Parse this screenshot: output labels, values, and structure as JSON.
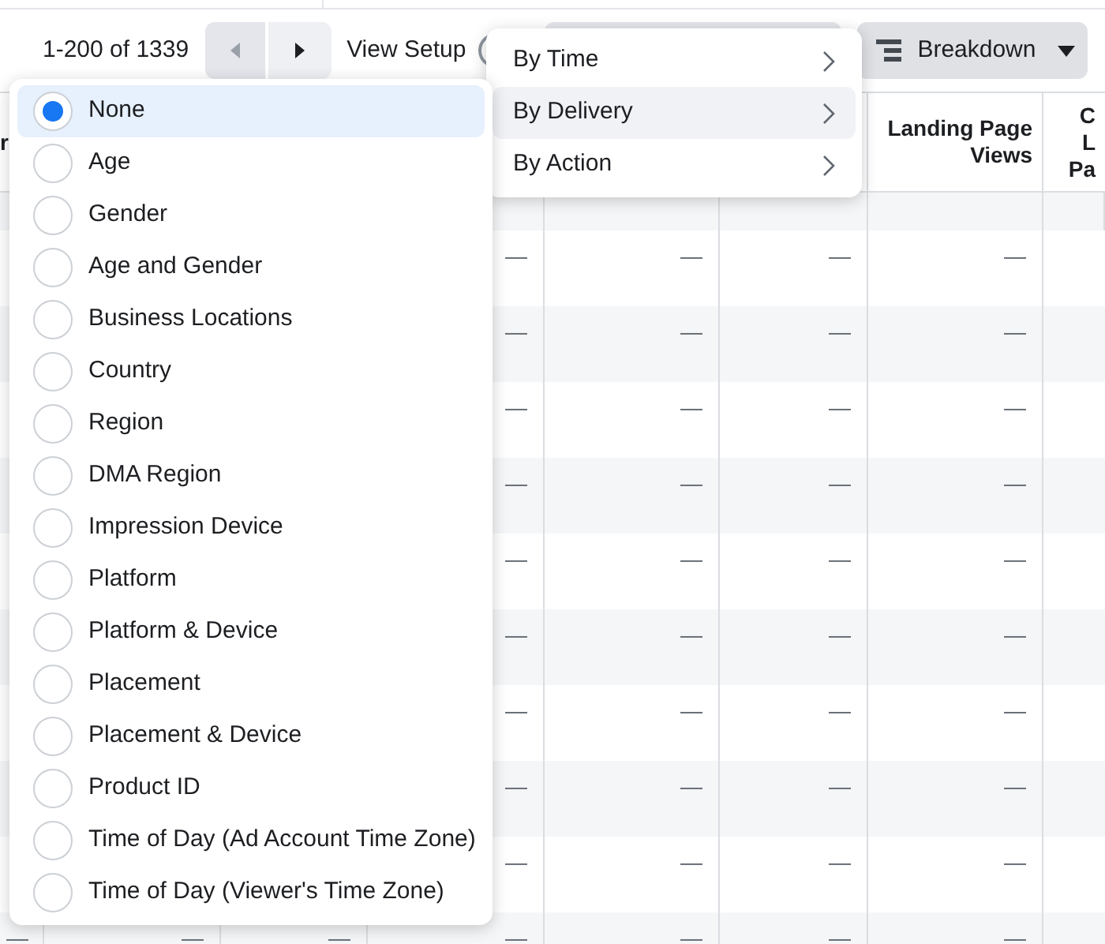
{
  "toolbar": {
    "range": "1-200 of 1339",
    "prev_disabled": true,
    "next_disabled": false,
    "view_setup": "View Setup",
    "view_setup_on": false,
    "breakdown": "Breakdown"
  },
  "breakdown_menu": [
    {
      "label": "By Time",
      "selected": false
    },
    {
      "label": "By Delivery",
      "selected": true
    },
    {
      "label": "By Action",
      "selected": false
    }
  ],
  "delivery_options": [
    {
      "label": "None",
      "selected": true
    },
    {
      "label": "Age",
      "selected": false
    },
    {
      "label": "Gender",
      "selected": false
    },
    {
      "label": "Age and Gender",
      "selected": false
    },
    {
      "label": "Business Locations",
      "selected": false
    },
    {
      "label": "Country",
      "selected": false
    },
    {
      "label": "Region",
      "selected": false
    },
    {
      "label": "DMA Region",
      "selected": false
    },
    {
      "label": "Impression Device",
      "selected": false
    },
    {
      "label": "Platform",
      "selected": false
    },
    {
      "label": "Platform & Device",
      "selected": false
    },
    {
      "label": "Placement",
      "selected": false
    },
    {
      "label": "Placement & Device",
      "selected": false
    },
    {
      "label": "Product ID",
      "selected": false
    },
    {
      "label": "Time of Day (Ad Account Time Zone)",
      "selected": false
    },
    {
      "label": "Time of Day (Viewer's Time Zone)",
      "selected": false
    }
  ],
  "table": {
    "columns": [
      {
        "header": [
          "r"
        ]
      },
      {},
      {},
      {},
      {},
      {},
      {
        "header": [
          "Landing Page",
          "Views"
        ]
      },
      {
        "header": [
          "C",
          "L",
          "Pa"
        ]
      }
    ],
    "rows": [
      {
        "cells": [
          "",
          "",
          "",
          "—",
          "—",
          "—",
          "—"
        ]
      },
      {
        "cells": [
          "",
          "",
          "",
          "—",
          "—",
          "—",
          "—"
        ]
      },
      {
        "cells": [
          "",
          "",
          "",
          "—",
          "—",
          "—",
          "—"
        ]
      },
      {
        "cells": [
          "",
          "",
          "",
          "—",
          "—",
          "—",
          "—"
        ]
      },
      {
        "cells": [
          "",
          "",
          "",
          "—",
          "—",
          "—",
          "—"
        ]
      },
      {
        "cells": [
          "",
          "",
          "",
          "—",
          "—",
          "—",
          "—"
        ]
      },
      {
        "cells": [
          "",
          "",
          "",
          "—",
          "—",
          "—",
          "—"
        ]
      },
      {
        "cells": [
          "",
          "",
          "",
          "—",
          "—",
          "—",
          "—"
        ]
      },
      {
        "cells": [
          "",
          "",
          "",
          "—",
          "—",
          "—",
          "—"
        ]
      },
      {
        "cells": [
          "—",
          "—",
          "—",
          "—",
          "—",
          "—",
          "—"
        ]
      }
    ]
  }
}
